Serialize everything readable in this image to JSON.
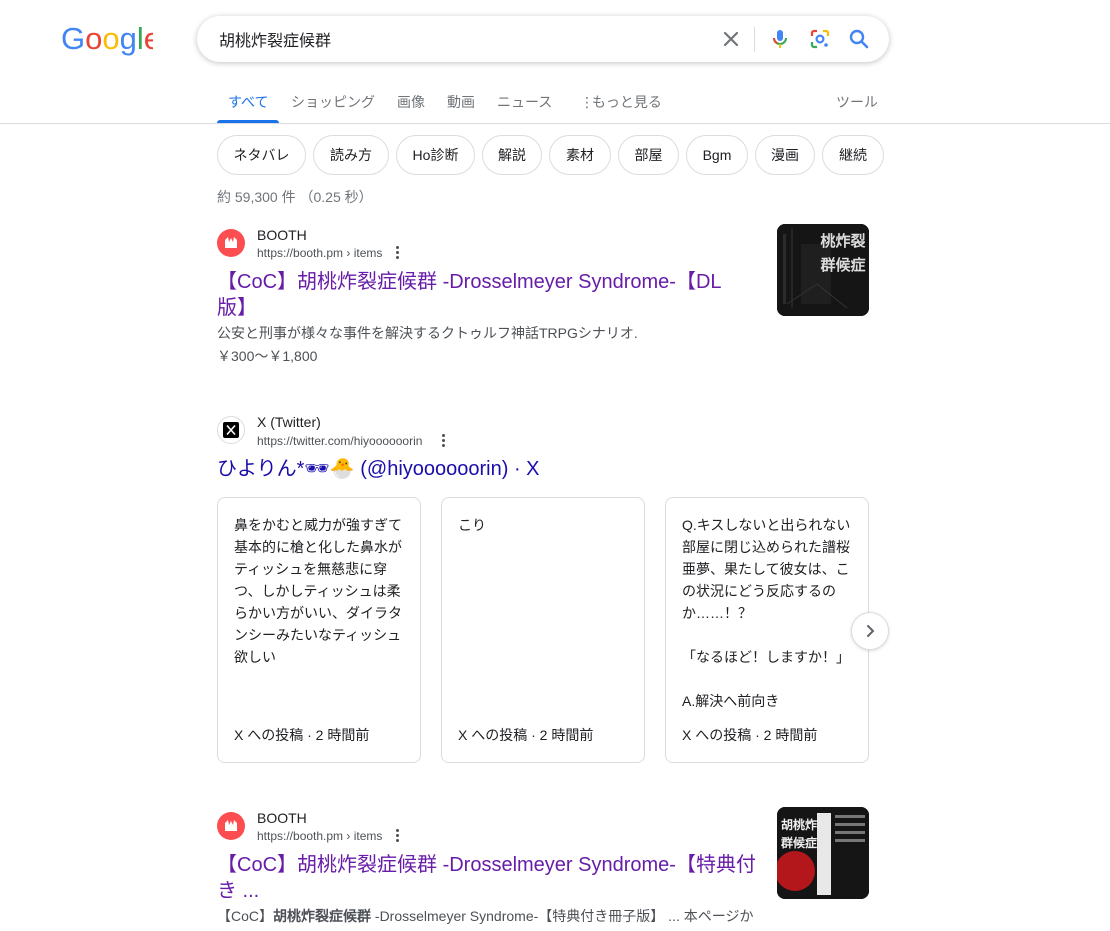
{
  "logo": {
    "text": "Google"
  },
  "search": {
    "query": "胡桃炸裂症候群"
  },
  "tabs": [
    {
      "label": "すべて",
      "active": true
    },
    {
      "label": "ショッピング"
    },
    {
      "label": "画像"
    },
    {
      "label": "動画"
    },
    {
      "label": "ニュース"
    },
    {
      "label": "もっと見る"
    }
  ],
  "tools_label": "ツール",
  "chips": [
    "ネタバレ",
    "読み方",
    "Ho診断",
    "解説",
    "素材",
    "部屋",
    "Bgm",
    "漫画",
    "継続"
  ],
  "stats": "約 59,300 件 （0.25 秒）",
  "results": [
    {
      "site": "BOOTH",
      "url": "https://booth.pm › items",
      "title_line1": "【CoC】胡桃炸裂症候群 -Drosselmeyer Syndrome-【DL",
      "title_line2": "版】",
      "snippet": "公安と刑事が様々な事件を解決するクトゥルフ神話TRPGシナリオ.",
      "price": "￥300～￥1,800",
      "thumb_text": "桃炸裂\n群候症"
    },
    {
      "site": "X (Twitter)",
      "url": "https://twitter.com/hiyoooooorin",
      "title": "ひよりん*🕶🐣 (@hiyoooooorin) · X"
    },
    {
      "site": "BOOTH",
      "url": "https://booth.pm › items",
      "title_line1": "【CoC】胡桃炸裂症候群 -Drosselmeyer Syndrome-【特典付",
      "title_line2": "き ...",
      "snippet_pre": "【CoC】",
      "snippet_bold": "胡桃炸裂症候群",
      "snippet_post": " -Drosselmeyer Syndrome-【特典付き冊子版】 ... 本ページか",
      "thumb_text": "胡桃炸裂\n群候症"
    }
  ],
  "tweets": [
    {
      "text": "鼻をかむと威力が強すぎて\n基本的に槍と化した鼻水が\nティッシュを無慈悲に穿\nつ、しかしティッシュは柔\nらかい方がいい、ダイラタ\nンシーみたいなティッシュ\n欲しい",
      "meta": "X への投稿 · 2 時間前"
    },
    {
      "text": "こり",
      "meta": "X への投稿 · 2 時間前"
    },
    {
      "text": "Q.キスしないと出られない\n部屋に閉じ込められた譜桜\n亜夢、果たして彼女は、こ\nの状況にどう反応するの\nか……！？\n\n「なるほど！しますか！」\n\nA.解決へ前向き",
      "meta": "X への投稿 · 2 時間前"
    }
  ],
  "colors": {
    "link_visited": "#681da8",
    "link": "#1a0dab",
    "tab_active": "#1a73e8",
    "booth_red": "#fc4d50"
  }
}
